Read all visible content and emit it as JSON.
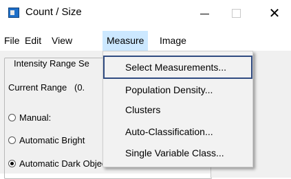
{
  "window": {
    "title": "Count / Size",
    "minimize_glyph": "—",
    "close_glyph": "✕"
  },
  "menubar": {
    "items": [
      {
        "label": "File"
      },
      {
        "label": "Edit"
      },
      {
        "label": "View"
      },
      {
        "label": "Measure"
      },
      {
        "label": "Image"
      }
    ]
  },
  "dialog": {
    "group_label": "Intensity Range Se",
    "current_range_label": "Current Range",
    "current_range_value": "(0.",
    "radios": [
      {
        "label": "Manual:",
        "checked": false
      },
      {
        "label": "Automatic Bright",
        "checked": false
      },
      {
        "label": "Automatic Dark Objects",
        "checked": true
      }
    ]
  },
  "measure_menu": {
    "items": [
      {
        "label": "Select Measurements..."
      },
      {
        "label": "Population Density..."
      },
      {
        "label": "Clusters"
      },
      {
        "label": "Auto-Classification..."
      },
      {
        "label": "Single Variable Class..."
      }
    ]
  },
  "colors": {
    "active_menu": "#cce8ff",
    "highlight_border": "#2f4a80"
  }
}
